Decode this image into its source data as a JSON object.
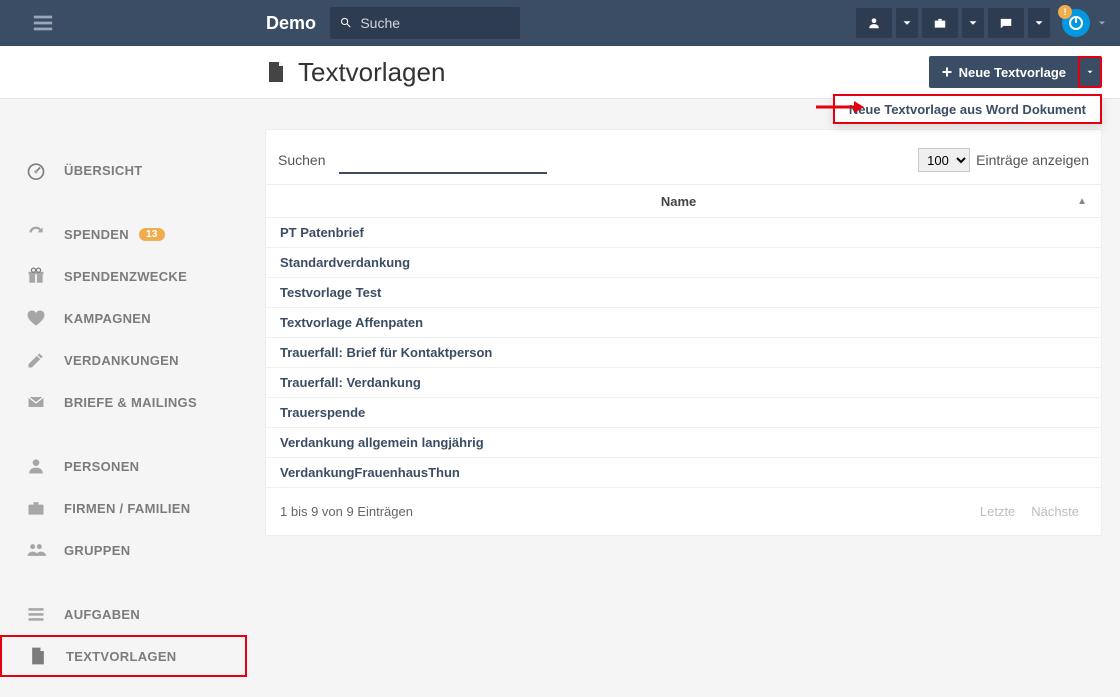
{
  "topbar": {
    "brand": "Demo",
    "search_placeholder": "Suche",
    "power_badge": "!"
  },
  "header": {
    "title": "Textvorlagen",
    "new_button": "Neue Textvorlage",
    "dropdown_item": "Neue Textvorlage aus Word Dokument"
  },
  "sidebar": {
    "items": [
      {
        "label": "ÜBERSICHT",
        "icon": "dashboard"
      },
      {
        "label": "SPENDEN",
        "icon": "refresh",
        "badge": "13"
      },
      {
        "label": "SPENDENZWECKE",
        "icon": "gift"
      },
      {
        "label": "KAMPAGNEN",
        "icon": "heart"
      },
      {
        "label": "VERDANKUNGEN",
        "icon": "edit"
      },
      {
        "label": "BRIEFE & MAILINGS",
        "icon": "envelope"
      },
      {
        "label": "PERSONEN",
        "icon": "user"
      },
      {
        "label": "FIRMEN / FAMILIEN",
        "icon": "briefcase"
      },
      {
        "label": "GRUPPEN",
        "icon": "users"
      },
      {
        "label": "AUFGABEN",
        "icon": "tasks"
      },
      {
        "label": "TEXTVORLAGEN",
        "icon": "file",
        "active": true
      }
    ]
  },
  "table": {
    "search_label": "Suchen",
    "page_size": "100",
    "entries_label": "Einträge anzeigen",
    "col_name": "Name",
    "rows": [
      "PT Patenbrief",
      "Standardverdankung",
      "Testvorlage Test",
      "Textvorlage Affenpaten",
      "Trauerfall: Brief für Kontaktperson",
      "Trauerfall: Verdankung",
      "Trauerspende",
      "Verdankung allgemein langjährig",
      "VerdankungFrauenhausThun"
    ],
    "info": "1 bis 9 von 9 Einträgen",
    "prev": "Letzte",
    "next": "Nächste"
  }
}
